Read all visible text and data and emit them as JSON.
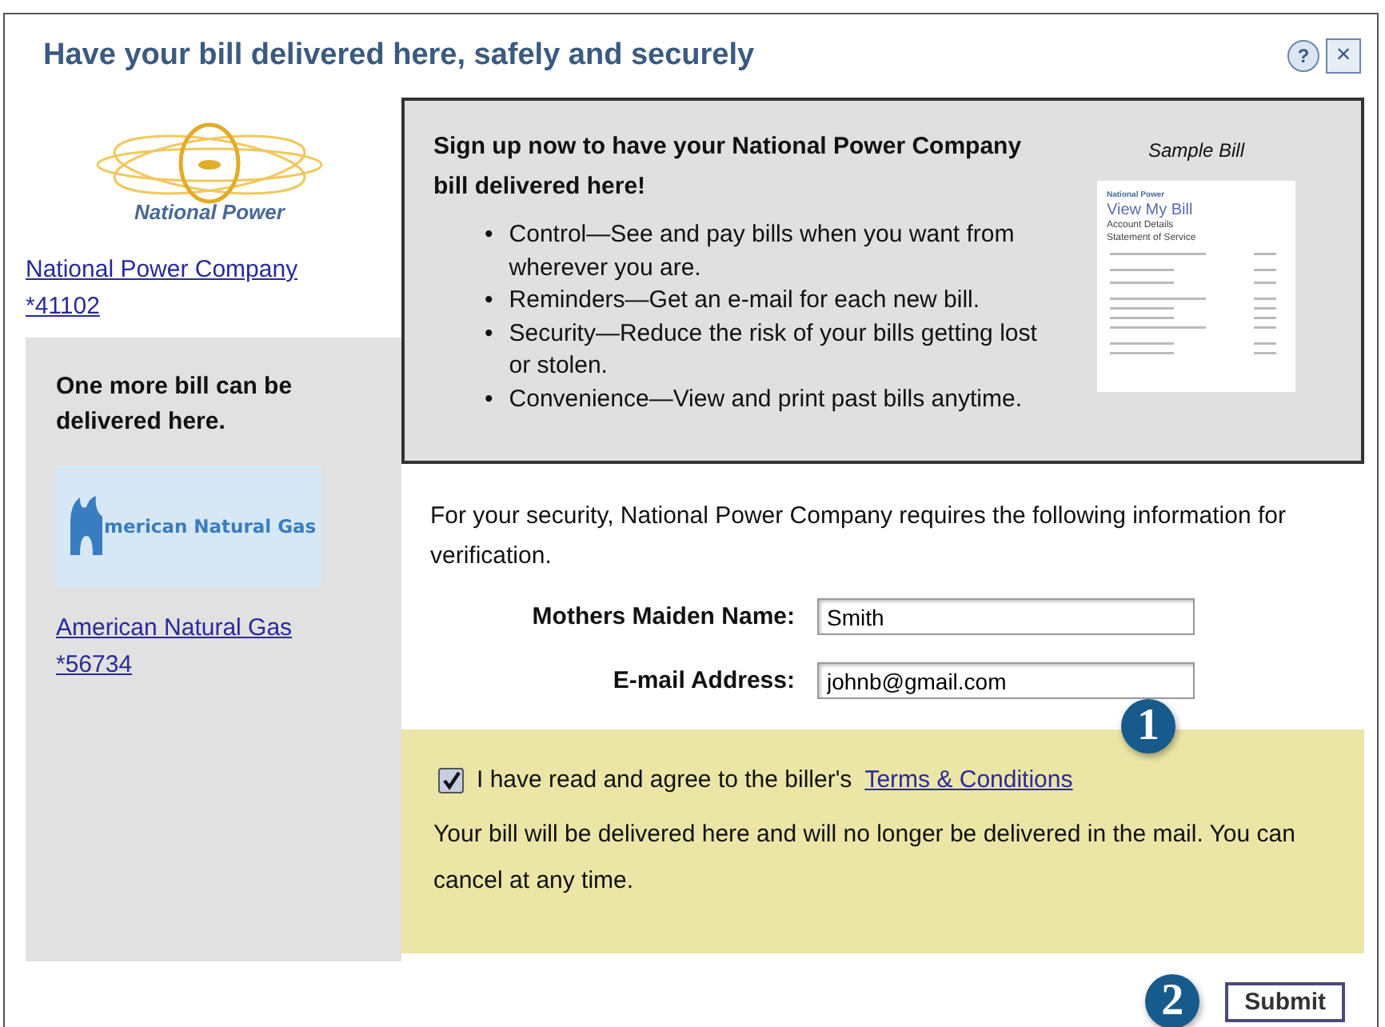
{
  "window": {
    "title": "Have your bill delivered here, safely and securely",
    "help_icon": "?",
    "close_icon": "×"
  },
  "sidebar": {
    "current_biller": {
      "logo_text": "National Power",
      "name": "National Power Company",
      "account": "*41102"
    },
    "more_panel": {
      "message": "One more bill can be delivered here.",
      "logo_text": "merican Natural Gas",
      "name": "American Natural Gas",
      "account": "*56734"
    }
  },
  "signup_box": {
    "heading": "Sign up now to have your National Power Company bill delivered here!",
    "bullet_marker": "•",
    "bullets": [
      "Control—See and pay bills when you want from wherever you are.",
      "Reminders—Get an e-mail for each new bill.",
      "Security—Reduce the risk of your bills getting lost or stolen.",
      "Convenience—View and print past bills anytime."
    ],
    "sample_caption": "Sample Bill",
    "sample_bill": {
      "title": "View My Bill",
      "lines": [
        "Account Details",
        "Statement of Service"
      ],
      "brand": "National Power"
    }
  },
  "verification": {
    "intro": "For your security, National Power Company requires the following information for verification.",
    "fields": [
      {
        "label": "Mothers Maiden Name:",
        "value": "Smith"
      },
      {
        "label": "E-mail Address:",
        "value": "johnb@gmail.com"
      }
    ]
  },
  "agreement": {
    "checked": true,
    "label": "I have read and agree to the biller's",
    "link": "Terms & Conditions",
    "note": "Your bill will be delivered here and will no longer be delivered in the mail. You can cancel at any time."
  },
  "callouts": [
    "1",
    "2"
  ],
  "submit_button": "Submit"
}
